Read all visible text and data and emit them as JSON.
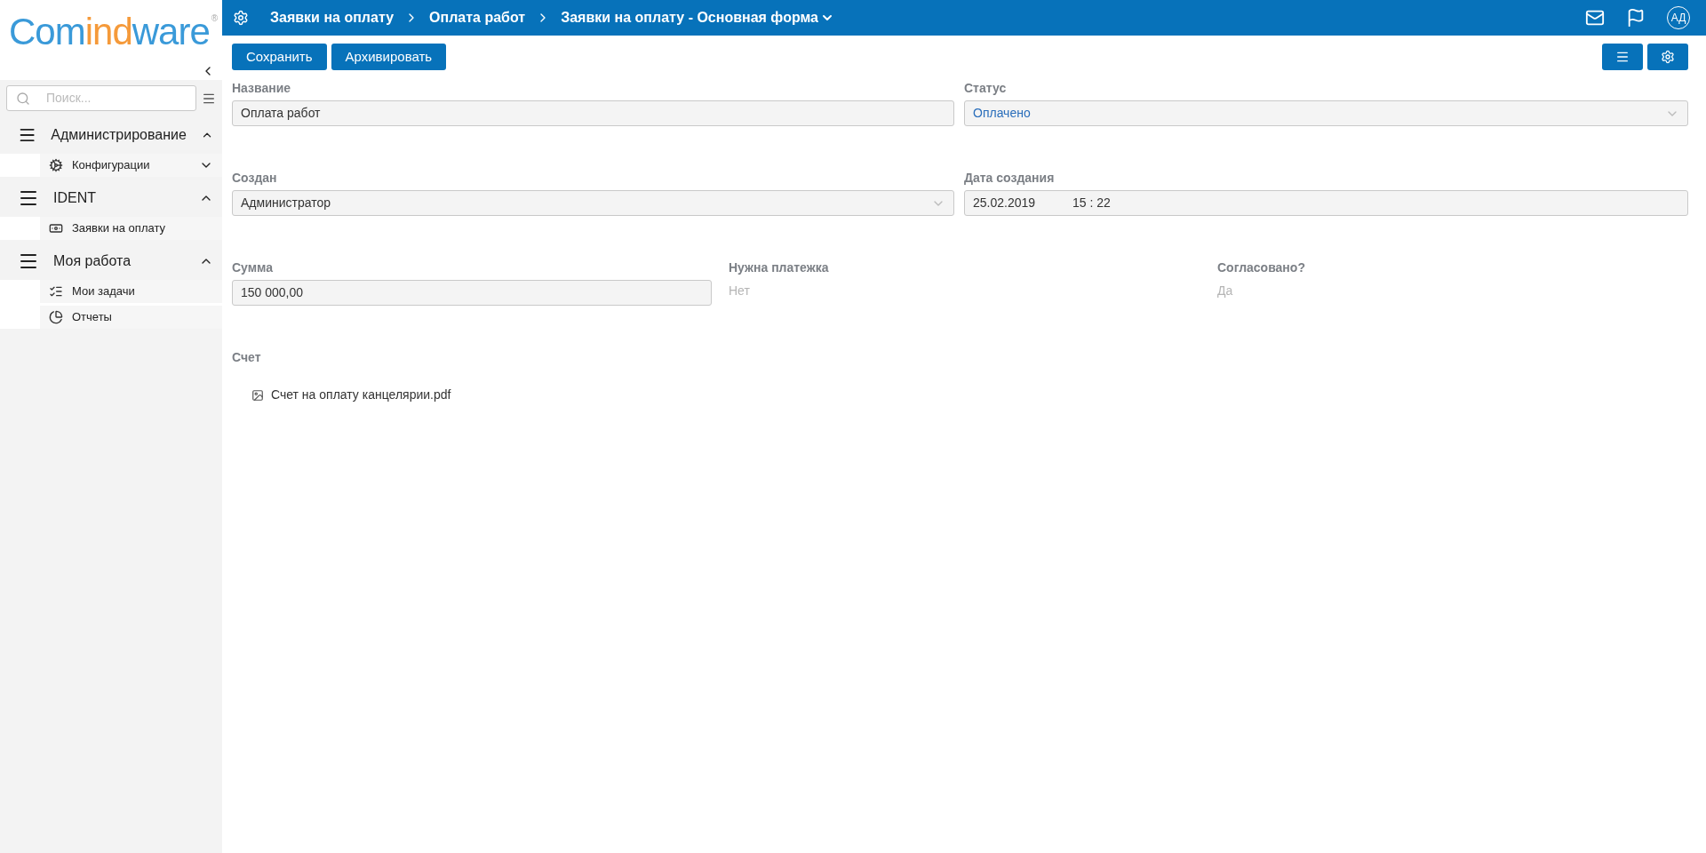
{
  "logo": {
    "part_1": "Com",
    "part_2": "ind",
    "part_3": "ware",
    "mark": "®"
  },
  "search": {
    "placeholder": "Поиск..."
  },
  "sidebar": {
    "groups": [
      {
        "label": "Администрирование",
        "expanded": true,
        "children": [
          {
            "label": "Конфигурации",
            "kind": "gears",
            "expanded": false
          }
        ]
      },
      {
        "label": "IDENT",
        "expanded": true,
        "children": [
          {
            "label": "Заявки на оплату",
            "kind": "money"
          }
        ]
      },
      {
        "label": "Моя работа",
        "expanded": true,
        "children": [
          {
            "label": "Мои задачи",
            "kind": "tasks"
          },
          {
            "label": "Отчеты",
            "kind": "chart"
          }
        ]
      }
    ]
  },
  "breadcrumbs": [
    "Заявки на оплату",
    "Оплата работ",
    "Заявки на оплату - Основная форма"
  ],
  "user": {
    "initials": "АД"
  },
  "toolbar": {
    "buttons": [
      "Сохранить",
      "Архивировать"
    ]
  },
  "form": {
    "rows": [
      [
        {
          "kind": "input",
          "label": "Название",
          "value": "Оплата работ"
        },
        {
          "kind": "select",
          "label": "Статус",
          "value": "Оплачено",
          "link": true
        }
      ],
      [
        {
          "kind": "select",
          "label": "Создан",
          "value": "Администратор",
          "link": false
        },
        {
          "kind": "datetime",
          "label": "Дата создания",
          "date": "25.02.2019",
          "time": "15 : 22"
        }
      ],
      [
        {
          "kind": "input",
          "label": "Сумма",
          "value": "150 000,00"
        },
        {
          "kind": "readonly",
          "label": "Нужна платежка",
          "value": "Нет"
        },
        {
          "kind": "readonly",
          "label": "Согласовано?",
          "value": "Да"
        }
      ]
    ],
    "attachment": {
      "label": "Счет",
      "file": "Счет на оплату канцелярии.pdf"
    }
  }
}
